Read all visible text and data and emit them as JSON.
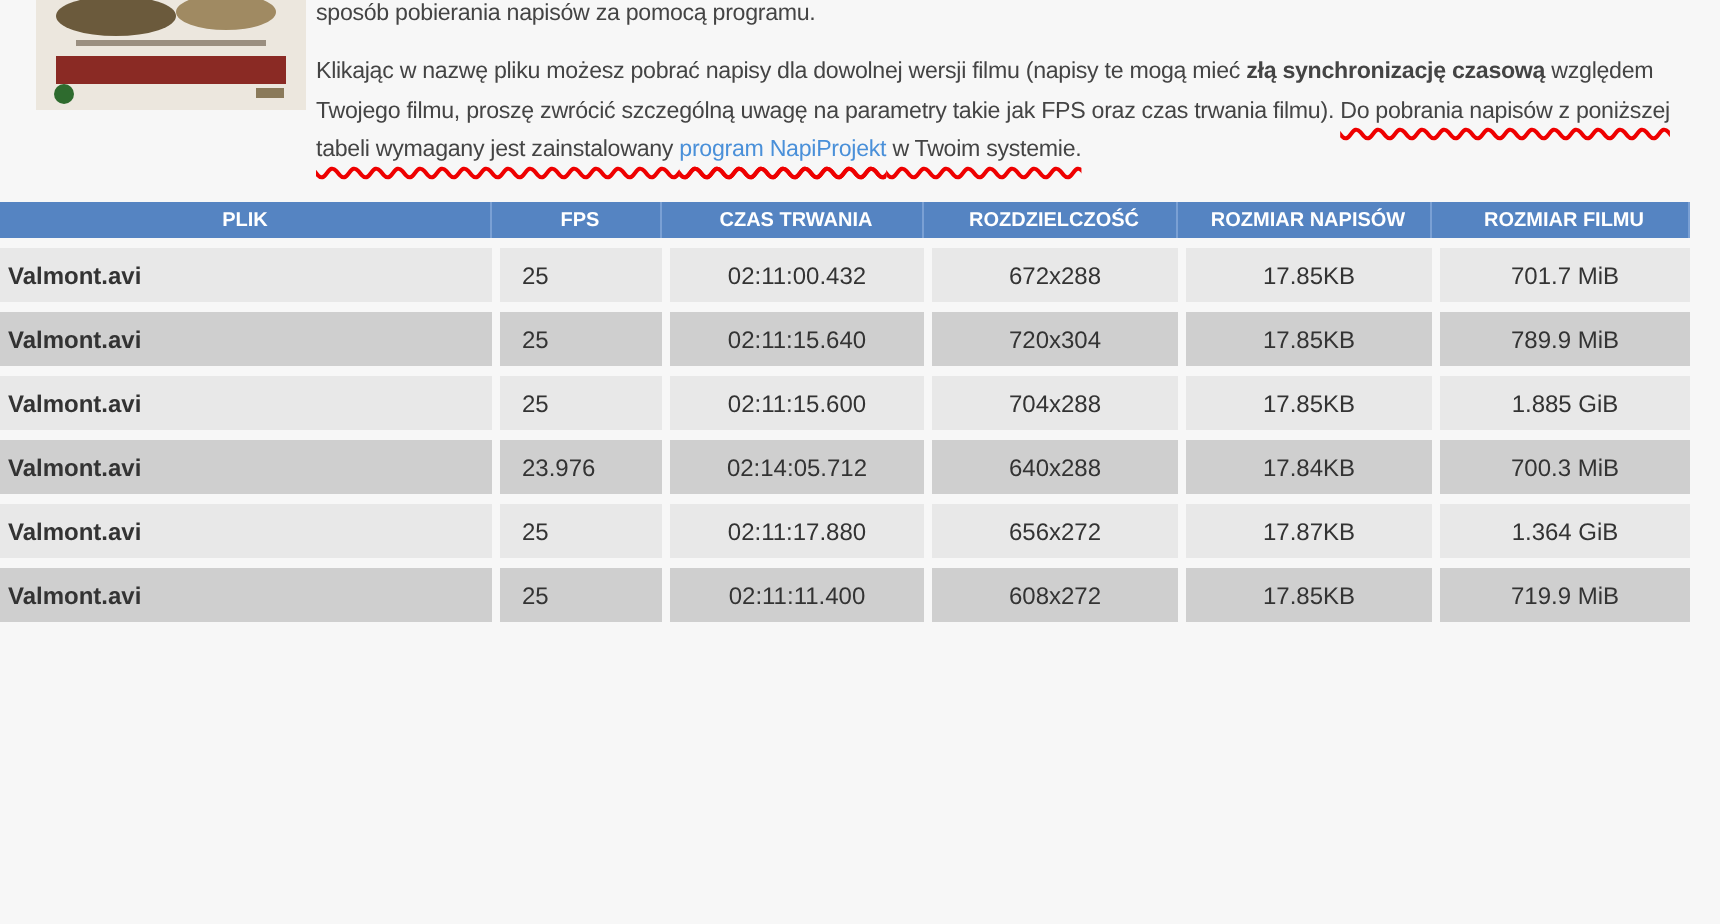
{
  "intro": {
    "top_line": "sposób pobierania napisów za pomocą programu.",
    "paragraph": "Klikając w nazwę pliku możesz pobrać napisy dla dowolnej wersji filmu (napisy te mogą mieć **złą synchronizację czasową** względem Twojego filmu, proszę zwrócić szczególną uwagę na parametry takie jak FPS oraz czas trwania filmu). ",
    "underlined": "Do pobrania napisów z poniższej tabeli wymagany jest zainstalowany ",
    "link": "program NapiProjekt",
    "paragraph_end": " w Twoim systemie."
  },
  "table": {
    "columns": [
      "PLIK",
      "FPS",
      "CZAS TRWANIA",
      "ROZDZIELCZOŚĆ",
      "ROZMIAR NAPISÓW",
      "ROZMIAR FILMU"
    ],
    "rows": [
      [
        "Valmont.avi",
        "25",
        "02:11:00.432",
        "672x288",
        "17.85KB",
        "701.7 MiB"
      ],
      [
        "Valmont.avi",
        "25",
        "02:11:15.640",
        "720x304",
        "17.85KB",
        "789.9 MiB"
      ],
      [
        "Valmont.avi",
        "25",
        "02:11:15.600",
        "704x288",
        "17.85KB",
        "1.885 GiB"
      ],
      [
        "Valmont.avi",
        "23.976",
        "02:14:05.712",
        "640x288",
        "17.84KB",
        "700.3 MiB"
      ],
      [
        "Valmont.avi",
        "25",
        "02:11:17.880",
        "656x272",
        "17.87KB",
        "1.364 GiB"
      ],
      [
        "Valmont.avi",
        "25",
        "02:11:11.400",
        "608x272",
        "17.85KB",
        "719.9 MiB"
      ]
    ]
  }
}
